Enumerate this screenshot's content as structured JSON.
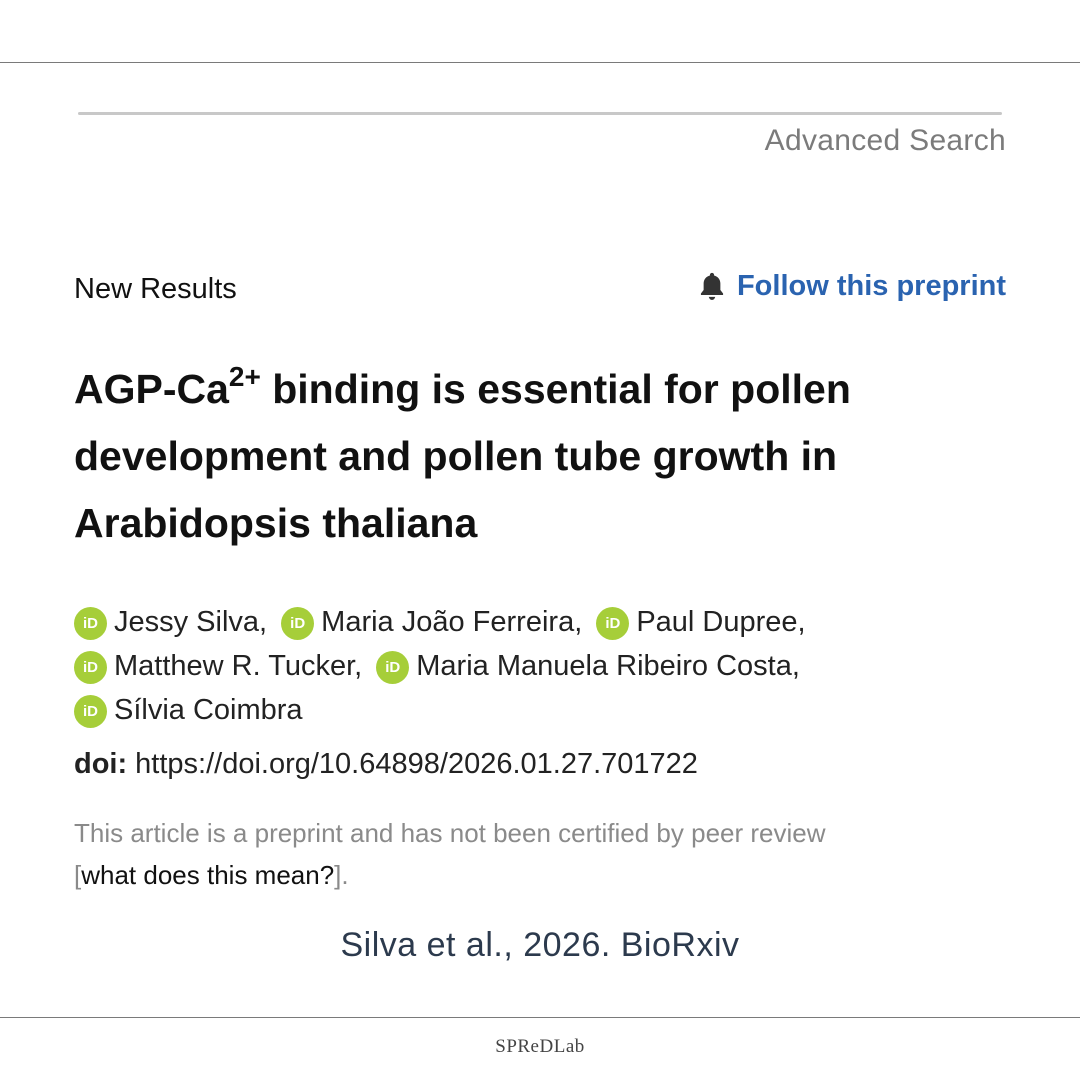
{
  "header": {
    "advanced_search_label": "Advanced Search"
  },
  "article": {
    "section_label": "New Results",
    "follow_label": "Follow this preprint",
    "title_part1": "AGP-Ca",
    "title_superscript": "2+",
    "title_part2": " binding is essential for pollen development and pollen tube growth in Arabidopsis thaliana",
    "authors": [
      "Jessy Silva,",
      "Maria João Ferreira,",
      "Paul Dupree,",
      "Matthew R. Tucker,",
      "Maria Manuela Ribeiro Costa,",
      "Sílvia Coimbra"
    ],
    "orcid_badge_text": "iD",
    "doi_label": "doi:",
    "doi_value": "https://doi.org/10.64898/2026.01.27.701722",
    "preprint_notice": "This article is a preprint and has not been certified by peer review",
    "preprint_bracket_open": "[",
    "preprint_link_label": "what does this mean?",
    "preprint_bracket_close": "]."
  },
  "caption": "Silva et al., 2026. BioRxiv",
  "footer": {
    "brand": "SPReDLab"
  },
  "colors": {
    "link_blue": "#2a63b0",
    "orcid_green": "#a6ce39",
    "caption_navy": "#2c3a4d"
  },
  "icons": {
    "follow": "bell-icon",
    "author": "orcid-icon"
  }
}
